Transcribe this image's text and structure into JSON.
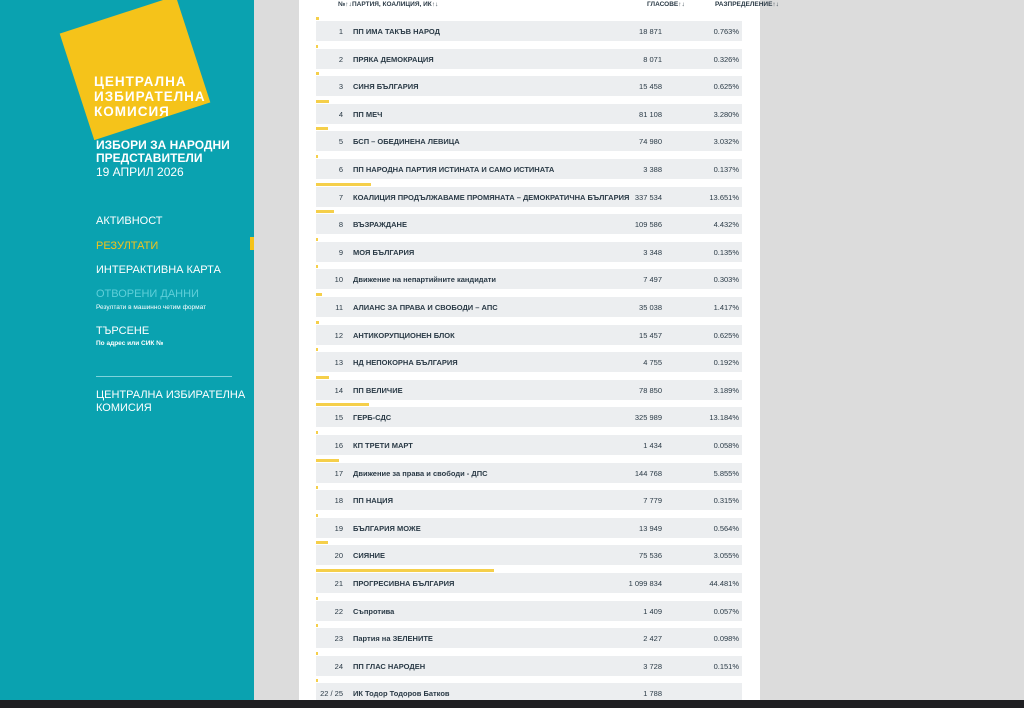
{
  "sidebar": {
    "logo_lines": [
      "ЦЕНТРАЛНА",
      "ИЗБИРАТЕЛНА",
      "КОМИСИЯ"
    ],
    "election_title": [
      "ИЗБОРИ ЗА НАРОДНИ",
      "ПРЕДСТАВИТЕЛИ"
    ],
    "election_date": "19 АПРИЛ 2026",
    "nav": [
      {
        "label": "АКТИВНОСТ"
      },
      {
        "label": "РЕЗУЛТАТИ"
      },
      {
        "label": "ИНТЕРАКТИВНА КАРТА"
      },
      {
        "label": "ОТВОРЕНИ ДАННИ",
        "sub": "Резултати в машинно четим формат"
      },
      {
        "label": "ТЪРСЕНЕ",
        "sub": "По адрес или СИК №"
      }
    ],
    "cik_link": [
      "ЦЕНТРАЛНА ИЗБИРАТЕЛНА",
      "КОМИСИЯ"
    ]
  },
  "table": {
    "headers": {
      "num": "№↑↓",
      "party": "ПАРТИЯ, КОАЛИЦИЯ, ИК↑↓",
      "votes": "ГЛАСОВЕ↑↓",
      "share": "РАЗПРЕДЕЛЕНИЕ↑↓"
    },
    "rows": [
      {
        "num": "1",
        "party": "ПП ИМА ТАКЪВ НАРОД",
        "votes": "18 871",
        "pct": "0.763%",
        "share": 0.763
      },
      {
        "num": "2",
        "party": "ПРЯКА ДЕМОКРАЦИЯ",
        "votes": "8 071",
        "pct": "0.326%",
        "share": 0.326
      },
      {
        "num": "3",
        "party": "СИНЯ БЪЛГАРИЯ",
        "votes": "15 458",
        "pct": "0.625%",
        "share": 0.625
      },
      {
        "num": "4",
        "party": "ПП МЕЧ",
        "votes": "81 108",
        "pct": "3.280%",
        "share": 3.28
      },
      {
        "num": "5",
        "party": "БСП – ОБЕДИНЕНА ЛЕВИЦА",
        "votes": "74 980",
        "pct": "3.032%",
        "share": 3.032
      },
      {
        "num": "6",
        "party": "ПП НАРОДНА ПАРТИЯ ИСТИНАТА И САМО ИСТИНАТА",
        "votes": "3 388",
        "pct": "0.137%",
        "share": 0.137
      },
      {
        "num": "7",
        "party": "КОАЛИЦИЯ ПРОДЪЛЖАВАМЕ ПРОМЯНАТА – ДЕМОКРАТИЧНА БЪЛГАРИЯ",
        "votes": "337 534",
        "pct": "13.651%",
        "share": 13.651
      },
      {
        "num": "8",
        "party": "ВЪЗРАЖДАНЕ",
        "votes": "109 586",
        "pct": "4.432%",
        "share": 4.432
      },
      {
        "num": "9",
        "party": "МОЯ БЪЛГАРИЯ",
        "votes": "3 348",
        "pct": "0.135%",
        "share": 0.135
      },
      {
        "num": "10",
        "party": "Движение на непартийните кандидати",
        "votes": "7 497",
        "pct": "0.303%",
        "share": 0.303
      },
      {
        "num": "11",
        "party": "АЛИАНС ЗА ПРАВА И СВОБОДИ – АПС",
        "votes": "35 038",
        "pct": "1.417%",
        "share": 1.417
      },
      {
        "num": "12",
        "party": "АНТИКОРУПЦИОНЕН БЛОК",
        "votes": "15 457",
        "pct": "0.625%",
        "share": 0.625
      },
      {
        "num": "13",
        "party": "НД НЕПОКОРНА БЪЛГАРИЯ",
        "votes": "4 755",
        "pct": "0.192%",
        "share": 0.192
      },
      {
        "num": "14",
        "party": "ПП ВЕЛИЧИЕ",
        "votes": "78 850",
        "pct": "3.189%",
        "share": 3.189
      },
      {
        "num": "15",
        "party": "ГЕРБ-СДС",
        "votes": "325 989",
        "pct": "13.184%",
        "share": 13.184
      },
      {
        "num": "16",
        "party": "КП ТРЕТИ МАРТ",
        "votes": "1 434",
        "pct": "0.058%",
        "share": 0.058
      },
      {
        "num": "17",
        "party": "Движение за права и свободи - ДПС",
        "votes": "144 768",
        "pct": "5.855%",
        "share": 5.855
      },
      {
        "num": "18",
        "party": "ПП НАЦИЯ",
        "votes": "7 779",
        "pct": "0.315%",
        "share": 0.315
      },
      {
        "num": "19",
        "party": "БЪЛГАРИЯ МОЖЕ",
        "votes": "13 949",
        "pct": "0.564%",
        "share": 0.564
      },
      {
        "num": "20",
        "party": "СИЯНИЕ",
        "votes": "75 536",
        "pct": "3.055%",
        "share": 3.055
      },
      {
        "num": "21",
        "party": "ПРОГРЕСИВНА БЪЛГАРИЯ",
        "votes": "1 099 834",
        "pct": "44.481%",
        "share": 44.481
      },
      {
        "num": "22",
        "party": "Съпротива",
        "votes": "1 409",
        "pct": "0.057%",
        "share": 0.057
      },
      {
        "num": "23",
        "party": "Партия на ЗЕЛЕНИТЕ",
        "votes": "2 427",
        "pct": "0.098%",
        "share": 0.098
      },
      {
        "num": "24",
        "party": "ПП ГЛАС НАРОДЕН",
        "votes": "3 728",
        "pct": "0.151%",
        "share": 0.151
      },
      {
        "num": "22 / 25",
        "party": "ИК Тодор Тодоров Батков",
        "votes": "1 788",
        "pct": "",
        "share": 0
      }
    ]
  },
  "colors": {
    "sidebar": "#0aa2b0",
    "accent": "#f5c31a",
    "row_bg": "#eceef0"
  }
}
